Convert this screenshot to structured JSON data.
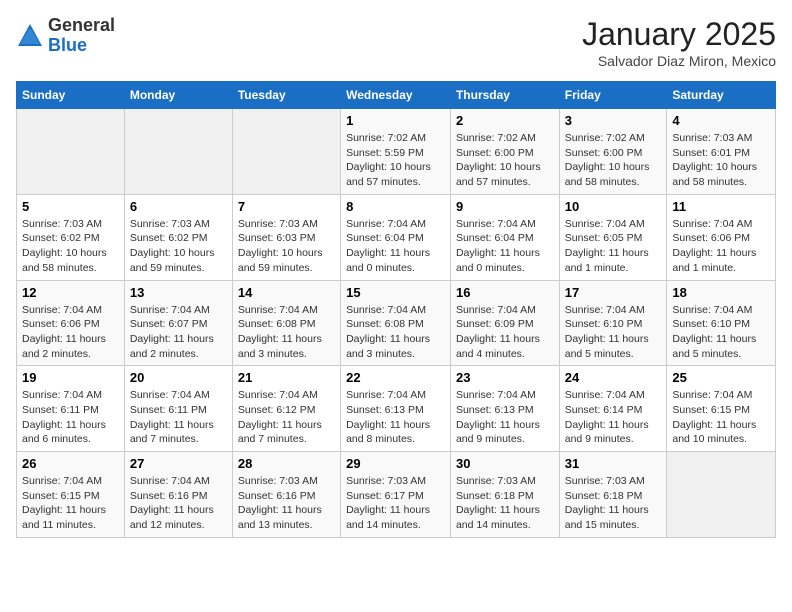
{
  "header": {
    "logo_general": "General",
    "logo_blue": "Blue",
    "month_title": "January 2025",
    "subtitle": "Salvador Diaz Miron, Mexico"
  },
  "days_of_week": [
    "Sunday",
    "Monday",
    "Tuesday",
    "Wednesday",
    "Thursday",
    "Friday",
    "Saturday"
  ],
  "weeks": [
    [
      {
        "num": "",
        "info": ""
      },
      {
        "num": "",
        "info": ""
      },
      {
        "num": "",
        "info": ""
      },
      {
        "num": "1",
        "info": "Sunrise: 7:02 AM\nSunset: 5:59 PM\nDaylight: 10 hours and 57 minutes."
      },
      {
        "num": "2",
        "info": "Sunrise: 7:02 AM\nSunset: 6:00 PM\nDaylight: 10 hours and 57 minutes."
      },
      {
        "num": "3",
        "info": "Sunrise: 7:02 AM\nSunset: 6:00 PM\nDaylight: 10 hours and 58 minutes."
      },
      {
        "num": "4",
        "info": "Sunrise: 7:03 AM\nSunset: 6:01 PM\nDaylight: 10 hours and 58 minutes."
      }
    ],
    [
      {
        "num": "5",
        "info": "Sunrise: 7:03 AM\nSunset: 6:02 PM\nDaylight: 10 hours and 58 minutes."
      },
      {
        "num": "6",
        "info": "Sunrise: 7:03 AM\nSunset: 6:02 PM\nDaylight: 10 hours and 59 minutes."
      },
      {
        "num": "7",
        "info": "Sunrise: 7:03 AM\nSunset: 6:03 PM\nDaylight: 10 hours and 59 minutes."
      },
      {
        "num": "8",
        "info": "Sunrise: 7:04 AM\nSunset: 6:04 PM\nDaylight: 11 hours and 0 minutes."
      },
      {
        "num": "9",
        "info": "Sunrise: 7:04 AM\nSunset: 6:04 PM\nDaylight: 11 hours and 0 minutes."
      },
      {
        "num": "10",
        "info": "Sunrise: 7:04 AM\nSunset: 6:05 PM\nDaylight: 11 hours and 1 minute."
      },
      {
        "num": "11",
        "info": "Sunrise: 7:04 AM\nSunset: 6:06 PM\nDaylight: 11 hours and 1 minute."
      }
    ],
    [
      {
        "num": "12",
        "info": "Sunrise: 7:04 AM\nSunset: 6:06 PM\nDaylight: 11 hours and 2 minutes."
      },
      {
        "num": "13",
        "info": "Sunrise: 7:04 AM\nSunset: 6:07 PM\nDaylight: 11 hours and 2 minutes."
      },
      {
        "num": "14",
        "info": "Sunrise: 7:04 AM\nSunset: 6:08 PM\nDaylight: 11 hours and 3 minutes."
      },
      {
        "num": "15",
        "info": "Sunrise: 7:04 AM\nSunset: 6:08 PM\nDaylight: 11 hours and 3 minutes."
      },
      {
        "num": "16",
        "info": "Sunrise: 7:04 AM\nSunset: 6:09 PM\nDaylight: 11 hours and 4 minutes."
      },
      {
        "num": "17",
        "info": "Sunrise: 7:04 AM\nSunset: 6:10 PM\nDaylight: 11 hours and 5 minutes."
      },
      {
        "num": "18",
        "info": "Sunrise: 7:04 AM\nSunset: 6:10 PM\nDaylight: 11 hours and 5 minutes."
      }
    ],
    [
      {
        "num": "19",
        "info": "Sunrise: 7:04 AM\nSunset: 6:11 PM\nDaylight: 11 hours and 6 minutes."
      },
      {
        "num": "20",
        "info": "Sunrise: 7:04 AM\nSunset: 6:11 PM\nDaylight: 11 hours and 7 minutes."
      },
      {
        "num": "21",
        "info": "Sunrise: 7:04 AM\nSunset: 6:12 PM\nDaylight: 11 hours and 7 minutes."
      },
      {
        "num": "22",
        "info": "Sunrise: 7:04 AM\nSunset: 6:13 PM\nDaylight: 11 hours and 8 minutes."
      },
      {
        "num": "23",
        "info": "Sunrise: 7:04 AM\nSunset: 6:13 PM\nDaylight: 11 hours and 9 minutes."
      },
      {
        "num": "24",
        "info": "Sunrise: 7:04 AM\nSunset: 6:14 PM\nDaylight: 11 hours and 9 minutes."
      },
      {
        "num": "25",
        "info": "Sunrise: 7:04 AM\nSunset: 6:15 PM\nDaylight: 11 hours and 10 minutes."
      }
    ],
    [
      {
        "num": "26",
        "info": "Sunrise: 7:04 AM\nSunset: 6:15 PM\nDaylight: 11 hours and 11 minutes."
      },
      {
        "num": "27",
        "info": "Sunrise: 7:04 AM\nSunset: 6:16 PM\nDaylight: 11 hours and 12 minutes."
      },
      {
        "num": "28",
        "info": "Sunrise: 7:03 AM\nSunset: 6:16 PM\nDaylight: 11 hours and 13 minutes."
      },
      {
        "num": "29",
        "info": "Sunrise: 7:03 AM\nSunset: 6:17 PM\nDaylight: 11 hours and 14 minutes."
      },
      {
        "num": "30",
        "info": "Sunrise: 7:03 AM\nSunset: 6:18 PM\nDaylight: 11 hours and 14 minutes."
      },
      {
        "num": "31",
        "info": "Sunrise: 7:03 AM\nSunset: 6:18 PM\nDaylight: 11 hours and 15 minutes."
      },
      {
        "num": "",
        "info": ""
      }
    ]
  ]
}
